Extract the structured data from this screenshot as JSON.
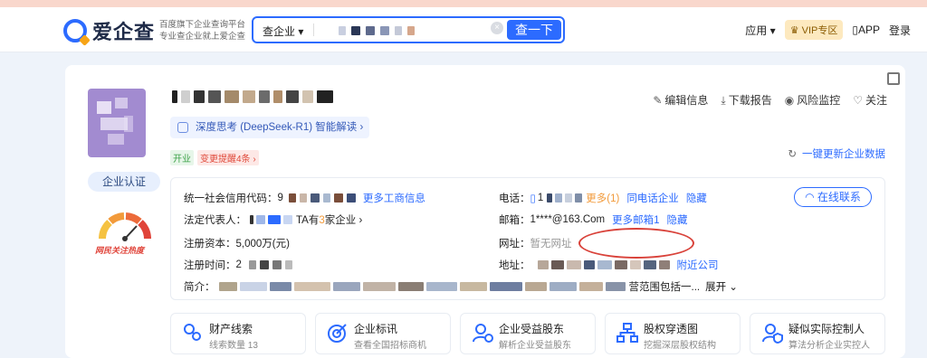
{
  "header": {
    "logo_text": "爱企查",
    "slogan_line1": "百度旗下企业查询平台",
    "slogan_line2": "专业查企业就上爱企查",
    "search_type": "查企业",
    "search_button": "查一下",
    "apps": "应用",
    "vip": "VIP专区",
    "app": "APP",
    "login": "登录"
  },
  "company": {
    "status_tag": "开业",
    "change_tag": "变更提醒4条",
    "deepseek": "深度思考 (DeepSeek-R1) 智能解读",
    "auth_button": "企业认证",
    "gauge_label": "网民关注热度"
  },
  "actions": {
    "edit": "编辑信息",
    "download": "下载报告",
    "monitor": "风险监控",
    "follow": "关注",
    "refresh": "一键更新企业数据"
  },
  "info": {
    "credit_label": "统一社会信用代码：",
    "credit_value": "9",
    "more_business": "更多工商信息",
    "legal_label": "法定代表人：",
    "legal_suffix_a": "TA有",
    "legal_count": "3",
    "legal_suffix_b": "家企业",
    "capital_label": "注册资本：",
    "capital_value": "5,000万(元)",
    "date_label": "注册时间：",
    "date_value": "2",
    "intro_label": "简介：",
    "intro_tail": "营范围包括一...",
    "expand": "展开",
    "phone_label": "电话：",
    "phone_value": "1",
    "phone_more": "更多(1)",
    "phone_same": "同电话企业",
    "phone_hide": "隐藏",
    "email_label": "邮箱：",
    "email_value": "1****@163.Com",
    "email_more": "更多邮箱1",
    "email_hide": "隐藏",
    "website_label": "网址：",
    "website_value": "暂无网址",
    "address_label": "地址：",
    "address_nearby": "附近公司",
    "online_contact": "在线联系"
  },
  "features": [
    {
      "title": "财产线索",
      "sub": "线索数量 13"
    },
    {
      "title": "企业标讯",
      "sub": "查看全国招标商机"
    },
    {
      "title": "企业受益股东",
      "sub": "解析企业受益股东"
    },
    {
      "title": "股权穿透图",
      "sub": "挖掘深层股权结构"
    },
    {
      "title": "疑似实际控制人",
      "sub": "算法分析企业实控人"
    }
  ],
  "colors": {
    "accent": "#2c6bff",
    "highlight_circle": "#d9423a",
    "avatar": "#a28bd0"
  }
}
